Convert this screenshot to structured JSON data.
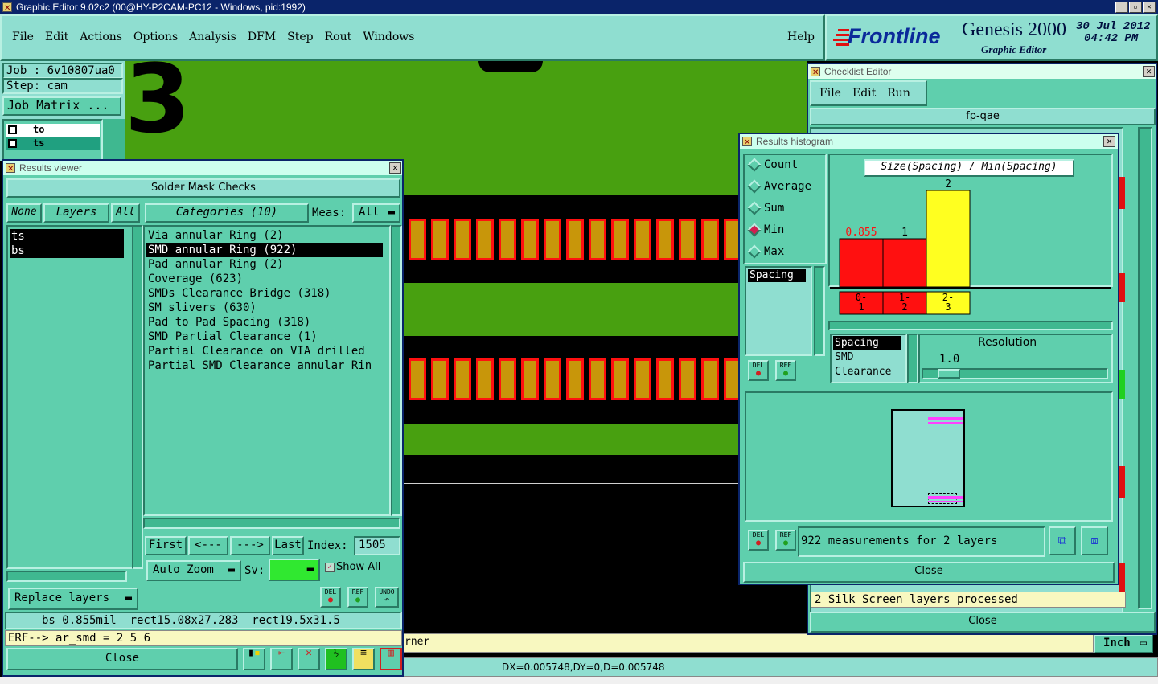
{
  "app": {
    "title": "Graphic Editor 9.02c2 (00@HY-P2CAM-PC12 - Windows, pid:1992)",
    "menu": [
      "File",
      "Edit",
      "Actions",
      "Options",
      "Analysis",
      "DFM",
      "Step",
      "Rout",
      "Windows"
    ],
    "help": "Help",
    "brand": "Frontline",
    "product": "Genesis 2000",
    "product_sub": "Graphic Editor",
    "date": "30 Jul 2012",
    "time": "04:42 PM"
  },
  "job": {
    "job": "Job : 6v10807ua0",
    "step": "Step: cam",
    "matrix_button": "Job Matrix ...",
    "layers": [
      {
        "name": "to"
      },
      {
        "name": "ts"
      }
    ]
  },
  "canvas": {
    "big_number": "3",
    "status_corner": "rner",
    "unit": "Inch",
    "coords": "DX=0.005748,DY=0,D=0.005748"
  },
  "results_viewer": {
    "title": "Results viewer",
    "header": "Solder Mask Checks",
    "none_btn": "None",
    "layers_btn": "Layers",
    "all_btn": "All",
    "categories_btn": "Categories (10)",
    "meas_label": "Meas:",
    "meas_value": "All",
    "layers": [
      "ts",
      "bs"
    ],
    "categories": [
      "Via annular Ring (2)",
      "SMD annular Ring (922)",
      "Pad annular Ring (2)",
      "Coverage (623)",
      "SMDs Clearance Bridge (318)",
      "SM slivers (630)",
      "Pad to Pad Spacing (318)",
      "SMD Partial Clearance (1)",
      "Partial Clearance on VIA drilled",
      "Partial SMD Clearance annular Rin"
    ],
    "selected_category": 1,
    "first": "First",
    "prev": "<---",
    "next": "--->",
    "last": "Last",
    "index_label": "Index:",
    "index_value": "1505",
    "auto_zoom": "Auto Zoom",
    "sv_label": "Sv:",
    "show_all": "Show All",
    "replace_layers": "Replace layers",
    "del": "DEL",
    "ref": "REF",
    "undo": "UNDO",
    "info": "bs 0.855mil  rect15.08x27.283  rect19.5x31.5",
    "erf": "ERF--> ar_smd = 2 5 6",
    "close": "Close"
  },
  "checklist": {
    "title": "Checklist Editor",
    "menu": [
      "File",
      "Edit",
      "Run"
    ],
    "name": "fp-qae",
    "status": "2 Silk Screen layers processed",
    "close": "Close"
  },
  "histogram": {
    "title": "Results histogram",
    "modes": [
      "Count",
      "Average",
      "Sum",
      "Min",
      "Max"
    ],
    "selected_mode": "Min",
    "chart_title": "Size(Spacing) / Min(Spacing)",
    "list1": [
      "Spacing"
    ],
    "list2": [
      "Spacing",
      "SMD",
      "Clearance"
    ],
    "resolution_label": "Resolution",
    "resolution_value": "1.0",
    "summary": "922 measurements for 2 layers",
    "del": "DEL",
    "ref": "REF",
    "close": "Close",
    "colors": {
      "red": "#ff1010",
      "yellow": "#ffff20"
    }
  },
  "chart_data": {
    "type": "bar",
    "title": "Size(Spacing) / Min(Spacing)",
    "categories": [
      "0-1",
      "1-2",
      "2-3"
    ],
    "values": [
      1,
      1,
      2
    ],
    "value_labels": [
      "0.855",
      "1",
      "2"
    ],
    "bin_labels": [
      [
        "0-",
        "1"
      ],
      [
        "1-",
        "2"
      ],
      [
        "2-",
        "3"
      ]
    ],
    "colors": [
      "#ff1010",
      "#ff1010",
      "#ffff20"
    ],
    "label_colors": [
      "#ff1010",
      "#000000",
      "#000000"
    ],
    "ylim": [
      0,
      2
    ]
  }
}
